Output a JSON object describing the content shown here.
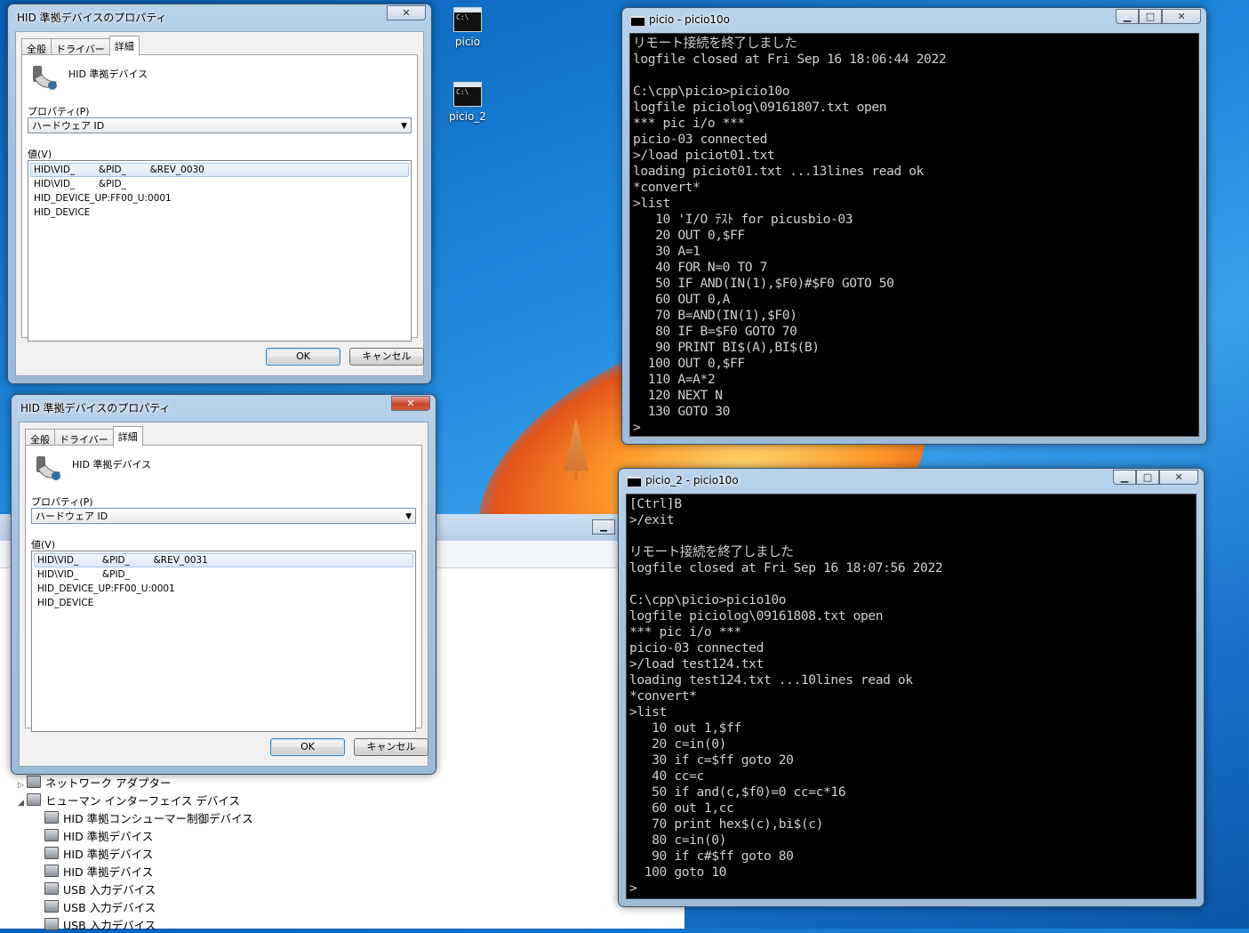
{
  "desktop": {
    "icons": [
      {
        "label": "picio"
      },
      {
        "label": "picio_2"
      }
    ],
    "icon_glyph": "C:\\"
  },
  "dialog1": {
    "title": "HID 準拠デバイスのプロパティ",
    "tabs": [
      "全般",
      "ドライバー",
      "詳細"
    ],
    "device_name": "HID 準拠デバイス",
    "property_label": "プロパティ(P)",
    "property_value": "ハードウェア ID",
    "value_label": "値(V)",
    "values": [
      "HID\\VID_        &PID_        &REV_0030",
      "HID\\VID_        &PID_",
      "HID_DEVICE_UP:FF00_U:0001",
      "HID_DEVICE"
    ],
    "ok": "OK",
    "cancel": "キャンセル"
  },
  "dialog2": {
    "title": "HID 準拠デバイスのプロパティ",
    "tabs": [
      "全般",
      "ドライバー",
      "詳細"
    ],
    "device_name": "HID 準拠デバイス",
    "property_label": "プロパティ(P)",
    "property_value": "ハードウェア ID",
    "value_label": "値(V)",
    "values": [
      "HID\\VID_        &PID_        &REV_0031",
      "HID\\VID_        &PID_",
      "HID_DEVICE_UP:FF00_U:0001",
      "HID_DEVICE"
    ],
    "ok": "OK",
    "cancel": "キャンセル"
  },
  "console1": {
    "title": "picio - picio10o",
    "text": "リモート接続を終了しました\nlogfile closed at Fri Sep 16 18:06:44 2022\n\nC:\\cpp\\picio>picio10o\nlogfile piciolog\\09161807.txt open\n*** pic i/o ***\npicio-03 connected\n>/load piciot01.txt\nloading piciot01.txt ...13lines read ok\n*convert*\n>list\n   10 'I/O ﾃｽﾄ for picusbio-03\n   20 OUT 0,$FF\n   30 A=1\n   40 FOR N=0 TO 7\n   50 IF AND(IN(1),$F0)#$F0 GOTO 50\n   60 OUT 0,A\n   70 B=AND(IN(1),$F0)\n   80 IF B=$F0 GOTO 70\n   90 PRINT BI$(A),BI$(B)\n  100 OUT 0,$FF\n  110 A=A*2\n  120 NEXT N\n  130 GOTO 30\n>"
  },
  "console2": {
    "title": "picio_2 - picio10o",
    "text": "[Ctrl]B\n>/exit\n\nリモート接続を終了しました\nlogfile closed at Fri Sep 16 18:07:56 2022\n\nC:\\cpp\\picio>picio10o\nlogfile piciolog\\09161808.txt open\n*** pic i/o ***\npicio-03 connected\n>/load test124.txt\nloading test124.txt ...10lines read ok\n*convert*\n>list\n   10 out 1,$ff\n   20 c=in(0)\n   30 if c=$ff goto 20\n   40 cc=c\n   50 if and(c,$f0)=0 cc=c*16\n   60 out 1,cc\n   70 print hex$(c),bi$(c)\n   80 c=in(0)\n   90 if c#$ff goto 80\n  100 goto 10\n>"
  },
  "device_manager": {
    "items": [
      {
        "label": "ネットワーク アダプター",
        "level": 0,
        "expander": "▷"
      },
      {
        "label": "ヒューマン インターフェイス デバイス",
        "level": 0,
        "expander": "◢"
      },
      {
        "label": "HID 準拠コンシューマー制御デバイス",
        "level": 1
      },
      {
        "label": "HID 準拠デバイス",
        "level": 1
      },
      {
        "label": "HID 準拠デバイス",
        "level": 1
      },
      {
        "label": "HID 準拠デバイス",
        "level": 1
      },
      {
        "label": "USB 入力デバイス",
        "level": 1
      },
      {
        "label": "USB 入力デバイス",
        "level": 1
      },
      {
        "label": "USB 入力デバイス",
        "level": 1
      }
    ]
  },
  "caption": {
    "min": "▁",
    "max": "□",
    "close": "✕"
  }
}
